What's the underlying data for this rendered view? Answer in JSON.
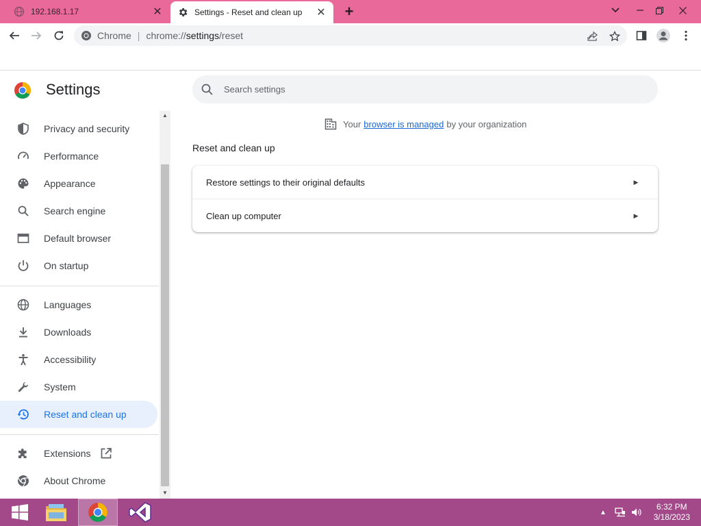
{
  "tabs": [
    {
      "title": "192.168.1.17",
      "icon": "globe-icon",
      "active": false
    },
    {
      "title": "Settings - Reset and clean up",
      "icon": "gear-icon",
      "active": true
    }
  ],
  "window_controls": {
    "tab_search": "chevron-down-icon",
    "minimize": "minimize-icon",
    "restore": "restore-icon",
    "close": "close-icon"
  },
  "toolbar": {
    "site_chip": "Chrome",
    "url_scheme": "chrome://",
    "url_host": "settings",
    "url_path": "/reset"
  },
  "settings": {
    "title": "Settings",
    "search_placeholder": "Search settings"
  },
  "sidebar": {
    "items": [
      {
        "label": "Privacy and security",
        "icon": "shield-icon"
      },
      {
        "label": "Performance",
        "icon": "speedometer-icon"
      },
      {
        "label": "Appearance",
        "icon": "palette-icon"
      },
      {
        "label": "Search engine",
        "icon": "search-icon"
      },
      {
        "label": "Default browser",
        "icon": "browser-window-icon"
      },
      {
        "label": "On startup",
        "icon": "power-icon"
      },
      {
        "label": "Languages",
        "icon": "globe-icon"
      },
      {
        "label": "Downloads",
        "icon": "download-icon"
      },
      {
        "label": "Accessibility",
        "icon": "accessibility-icon"
      },
      {
        "label": "System",
        "icon": "wrench-icon"
      },
      {
        "label": "Reset and clean up",
        "icon": "reset-history-icon",
        "active": true
      },
      {
        "label": "Extensions",
        "icon": "puzzle-icon"
      },
      {
        "label": "About Chrome",
        "icon": "chrome-icon"
      }
    ]
  },
  "managed_notice": {
    "prefix": "Your",
    "link": "browser is managed",
    "suffix": "by your organization"
  },
  "main": {
    "section_title": "Reset and clean up",
    "rows": [
      {
        "label": "Restore settings to their original defaults"
      },
      {
        "label": "Clean up computer"
      }
    ]
  },
  "taskbar": {
    "apps": [
      "windows-start-icon",
      "file-explorer-icon",
      "chrome-icon",
      "visual-studio-icon"
    ],
    "time": "6:32 PM",
    "date": "3/18/2023"
  },
  "colors": {
    "tabstrip": "#e8699a",
    "accent": "#1a73e8",
    "active_nav_bg": "#e8f0fe",
    "taskbar": "#a3498a"
  }
}
